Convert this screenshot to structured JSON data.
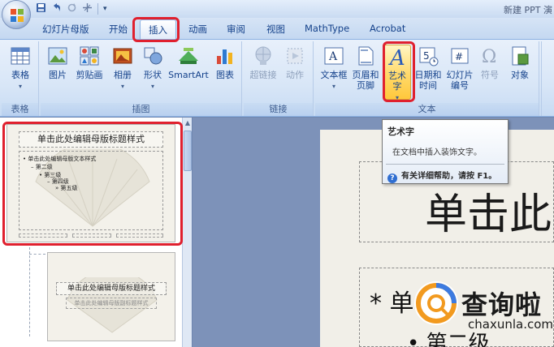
{
  "window": {
    "title": "新建 PPT 演"
  },
  "qat": {
    "save_icon": "save-icon",
    "undo_icon": "undo-icon",
    "redo_icon": "redo-icon",
    "customize_icon": "customize-icon",
    "more_label": "▾"
  },
  "tabs": [
    {
      "label": "幻灯片母版"
    },
    {
      "label": "开始"
    },
    {
      "label": "插入",
      "active": true
    },
    {
      "label": "动画"
    },
    {
      "label": "审阅"
    },
    {
      "label": "视图"
    },
    {
      "label": "MathType"
    },
    {
      "label": "Acrobat"
    }
  ],
  "ribbon": {
    "groups": {
      "table": {
        "label": "表格",
        "buttons": [
          {
            "label": "表格"
          }
        ]
      },
      "illustrations": {
        "label": "插图",
        "buttons": [
          {
            "label": "图片"
          },
          {
            "label": "剪贴画"
          },
          {
            "label": "相册"
          },
          {
            "label": "形状"
          },
          {
            "label": "SmartArt"
          },
          {
            "label": "图表"
          }
        ]
      },
      "links": {
        "label": "链接",
        "buttons": [
          {
            "label": "超链接"
          },
          {
            "label": "动作"
          }
        ]
      },
      "text": {
        "label": "文本",
        "buttons": [
          {
            "label_1": "文本框",
            "label_2": ""
          },
          {
            "label_1": "页眉和",
            "label_2": "页脚"
          },
          {
            "label_1": "艺术字",
            "label_2": ""
          },
          {
            "label_1": "日期和",
            "label_2": "时间"
          },
          {
            "label_1": "幻灯片",
            "label_2": "编号"
          },
          {
            "label_1": "符号",
            "label_2": ""
          },
          {
            "label_1": "对象",
            "label_2": ""
          }
        ]
      }
    }
  },
  "tooltip": {
    "title": "艺术字",
    "description": "在文档中插入装饰文字。",
    "help": "有关详细帮助，请按 F1。"
  },
  "thumbnails": [
    {
      "title": "单击此处编辑母版标题样式",
      "body": [
        "单击此处编辑母版文本样式",
        "第二级",
        "第三级",
        "第四级",
        "第五级"
      ]
    },
    {
      "title": "单击此处编辑母版标题样式",
      "subtitle": "单击此处编辑母版副标题样式"
    }
  ],
  "slide": {
    "title": "单击此",
    "bullet_1": "单",
    "bullet_2": "第二级"
  },
  "watermark": {
    "name": "查询啦",
    "url": "chaxunla.com"
  },
  "colors": {
    "accent": "#15428b",
    "highlight": "#ffd96a",
    "red_annotation": "#e0202e"
  }
}
